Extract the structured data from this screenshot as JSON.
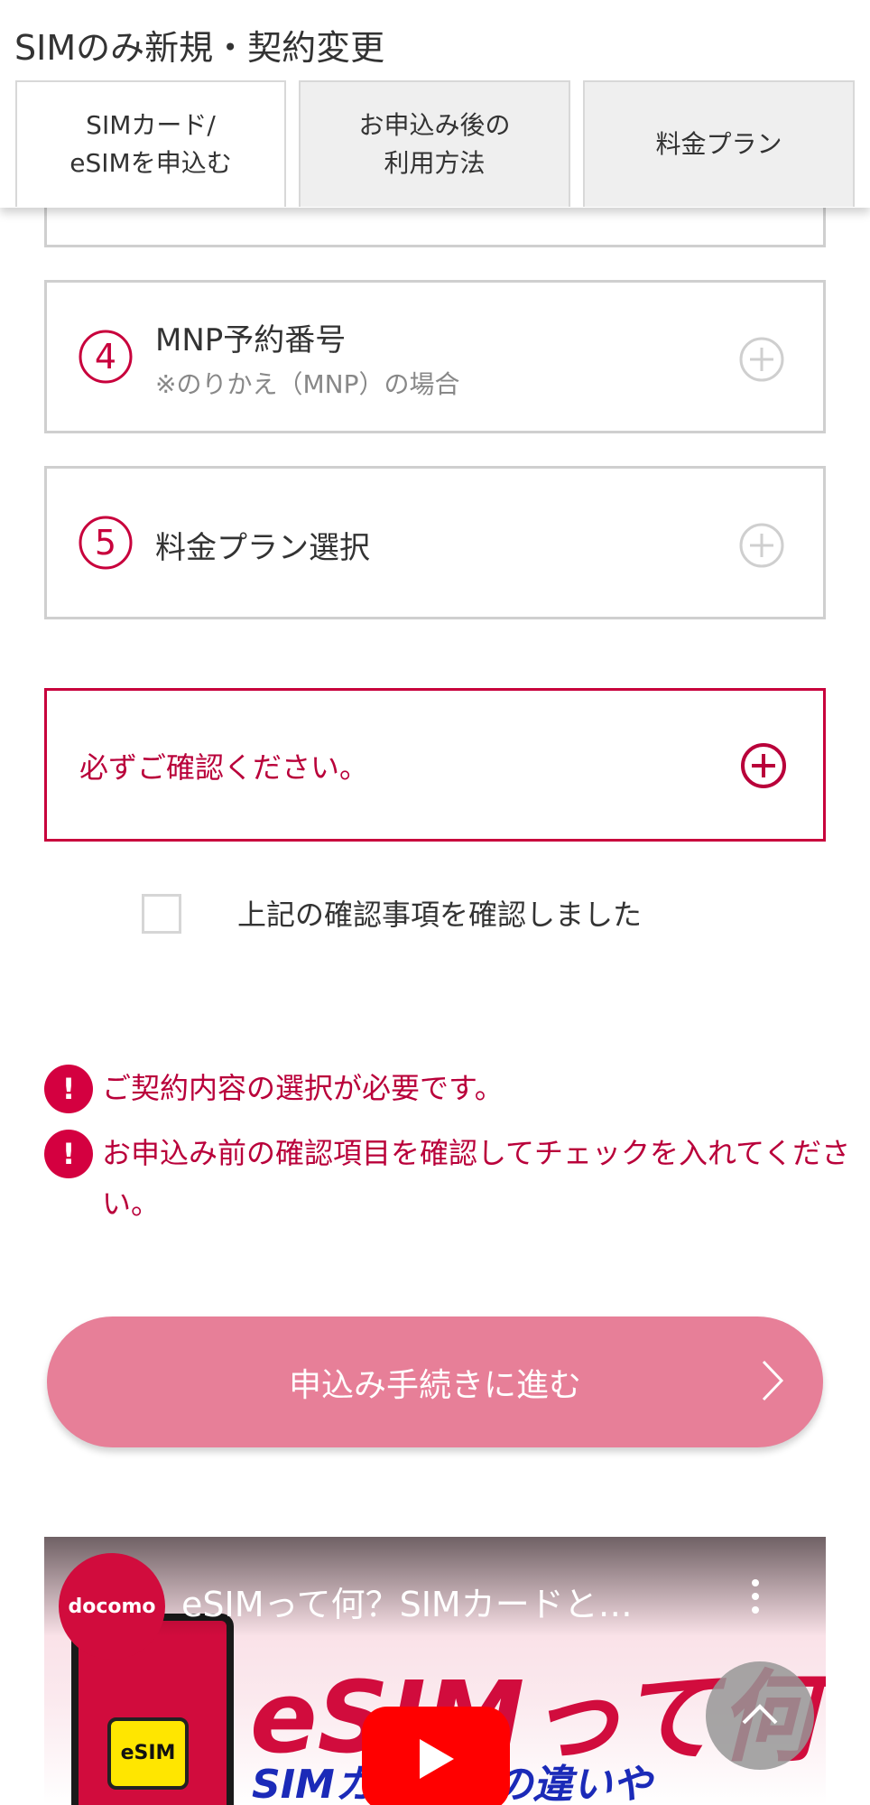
{
  "header": {
    "title": "SIMのみ新規・契約変更",
    "tabs": [
      {
        "label": "SIMカード/\neSIMを申込む",
        "active": true
      },
      {
        "label": "お申込み後の\n利用方法",
        "active": false
      },
      {
        "label": "料金プラン",
        "active": false
      }
    ]
  },
  "steps": [
    {
      "number": "4",
      "title": "MNP予約番号",
      "note": "※のりかえ（MNP）の場合"
    },
    {
      "number": "5",
      "title": "料金プラン選択"
    }
  ],
  "confirm": {
    "label": "必ずご確認ください。"
  },
  "checkbox": {
    "label": "上記の確認事項を確認しました",
    "checked": false
  },
  "errors": [
    {
      "icon": "!",
      "text": "ご契約内容の選択が必要です。"
    },
    {
      "icon": "!",
      "text": "お申込み前の確認項目を確認してチェックを入れてください。"
    }
  ],
  "cta": {
    "label": "申込み手続きに進む"
  },
  "video": {
    "channel_logo": "docomo",
    "title": "eSIMって何？SIMカードと…",
    "thumbnail_main_text": "eSIMって何？",
    "thumbnail_sub_text": "SIMカードとの違いや",
    "chip_label": "eSIM"
  },
  "colors": {
    "accent": "#c8003c",
    "cta_bg": "#e77f98",
    "error": "#d40040"
  }
}
